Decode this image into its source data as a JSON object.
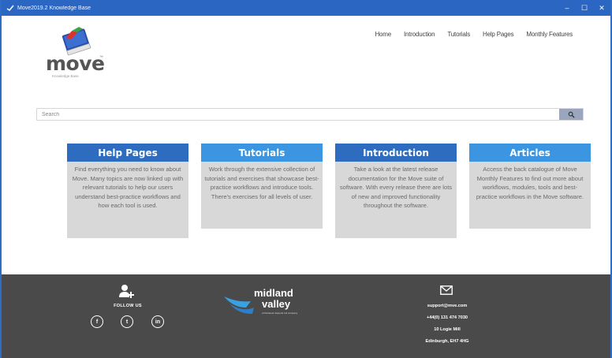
{
  "window": {
    "title": "Move2019.2 Knowledge Base",
    "controls": [
      "–",
      "☐",
      "✕"
    ]
  },
  "logo": {
    "word": "move",
    "tm": "™",
    "subtitle": "Knowledge Base"
  },
  "nav": {
    "items": [
      "Home",
      "Introduction",
      "Tutorials",
      "Help Pages",
      "Monthly Features"
    ]
  },
  "search": {
    "placeholder": "Search"
  },
  "cards": [
    {
      "title": "Help Pages",
      "color": "#2e6cc0",
      "text": "Find everything you need to know about Move. Many topics are now linked up with relevant tutorials to help our users understand best-practice workflows and how each tool is used."
    },
    {
      "title": "Tutorials",
      "color": "#3b95e0",
      "text": "Work through the extensive collection of tutorials and exercises that showcase best-practice workflows and introduce tools. There's exercises for all levels of user."
    },
    {
      "title": "Introduction",
      "color": "#2e6cc0",
      "text": "Take a look at the latest release documentation for the Move suite of software. With every release there are lots of new and improved functionality throughout the software."
    },
    {
      "title": "Articles",
      "color": "#3b95e0",
      "text": "Access the back catalogue of Move Monthly Features to find out more about workflows, modules, tools and best-practice workflows in the Move software."
    }
  ],
  "footer": {
    "follow_label": "FOLLOW US",
    "social": [
      "f",
      "t",
      "in"
    ],
    "partner_logo": {
      "line1": "midland",
      "line2": "valley",
      "tagline": "a Petroleum Experts Ltd company"
    },
    "contact": {
      "email": "support@mve.com",
      "phone": "+44(0) 131 474 7030",
      "address1": "10 Logie Mill",
      "address2": "Edinburgh, EH7 4HG"
    }
  },
  "colors": {
    "titlebar": "#2b66c3",
    "footer": "#4a4a4a",
    "card_body": "#d8d8d8"
  }
}
